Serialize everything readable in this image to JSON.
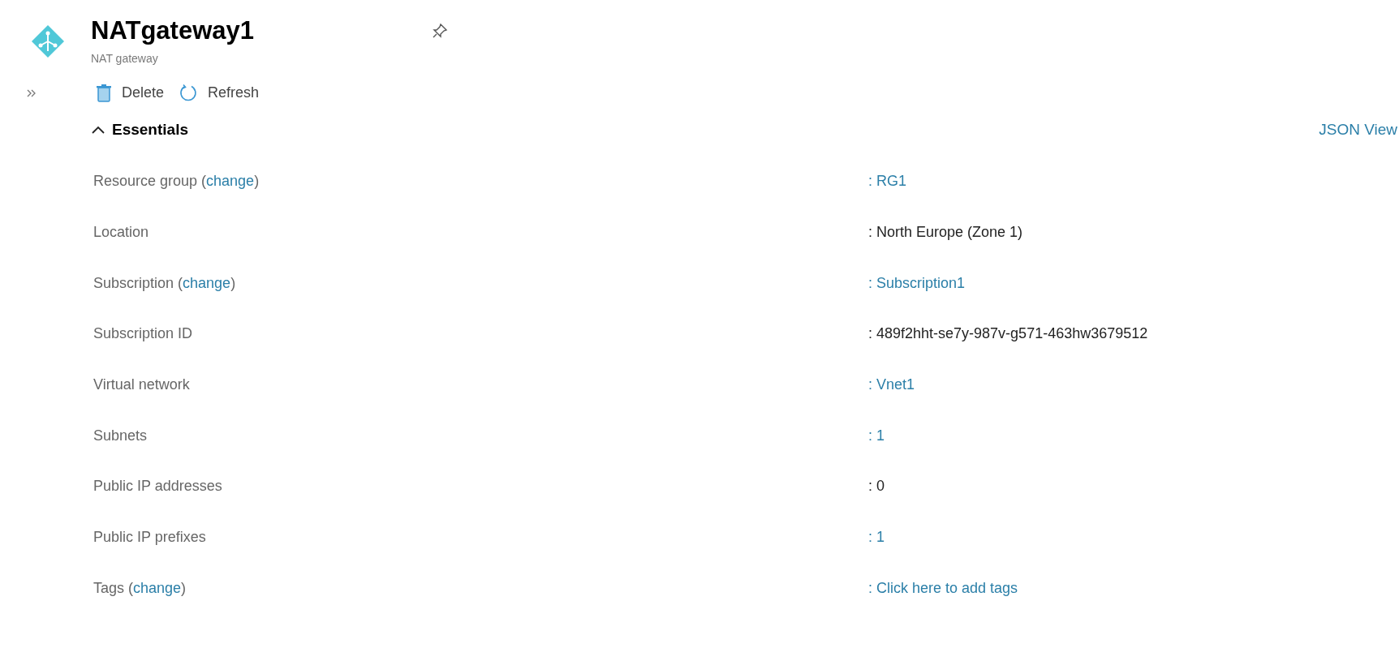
{
  "header": {
    "title": "NATgateway1",
    "subtitle": "NAT gateway"
  },
  "toolbar": [
    {
      "kind": "delete",
      "label": "Delete"
    },
    {
      "kind": "refresh",
      "label": "Refresh"
    }
  ],
  "essentials": {
    "title": "Essentials",
    "expanded": true,
    "json_view": "JSON View",
    "rows": [
      {
        "label": [
          {
            "text": "Resource group ("
          },
          {
            "text": "change",
            "link": true
          },
          {
            "text": ")"
          }
        ],
        "value": ": RG1",
        "link": true
      },
      {
        "label": [
          {
            "text": "Location"
          }
        ],
        "value": ": North Europe (Zone 1)",
        "link": false
      },
      {
        "label": [
          {
            "text": "Subscription ("
          },
          {
            "text": "change",
            "link": true
          },
          {
            "text": ")"
          }
        ],
        "value": ": Subscription1",
        "link": true
      },
      {
        "label": [
          {
            "text": "Subscription ID"
          }
        ],
        "value": ": 489f2hht-se7y-987v-g571-463hw3679512",
        "link": false
      },
      {
        "label": [
          {
            "text": "Virtual network"
          }
        ],
        "value": ": Vnet1",
        "link": true
      },
      {
        "label": [
          {
            "text": "Subnets"
          }
        ],
        "value": ": 1",
        "link": true
      },
      {
        "label": [
          {
            "text": "Public IP addresses"
          }
        ],
        "value": ": 0",
        "link": false
      },
      {
        "label": [
          {
            "text": "Public IP prefixes"
          }
        ],
        "value": ": 1",
        "link": true
      },
      {
        "label": [
          {
            "text": "Tags ("
          },
          {
            "text": "change",
            "link": true
          },
          {
            "text": ")"
          }
        ],
        "value": ": Click here to add tags",
        "link": true
      }
    ]
  }
}
